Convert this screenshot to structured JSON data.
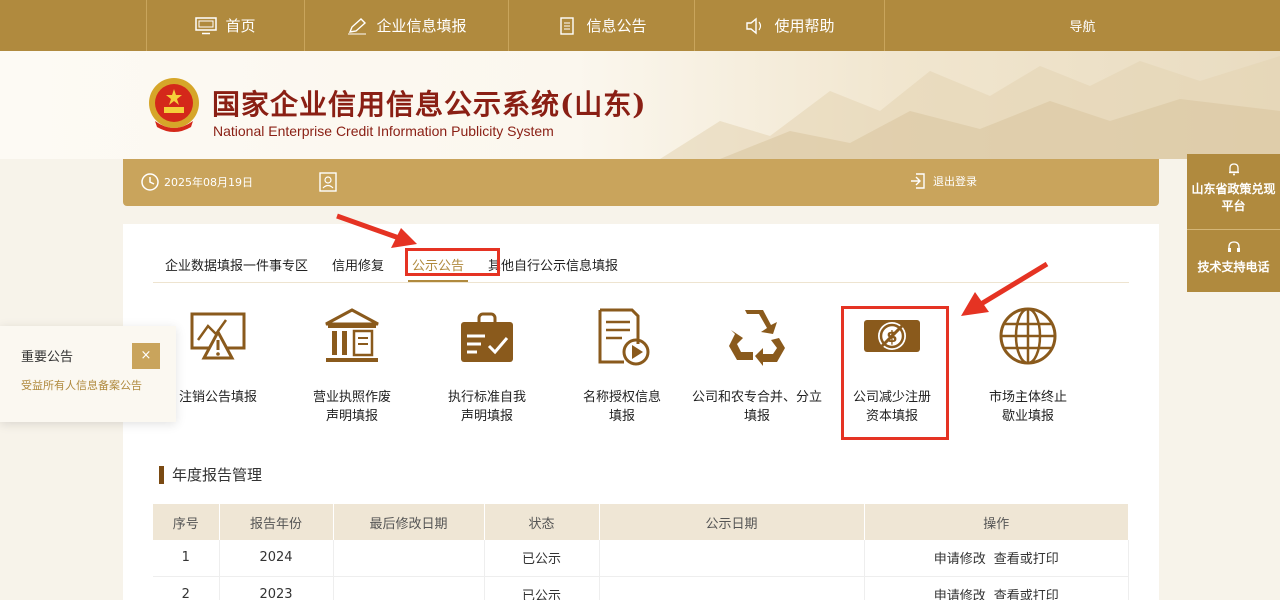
{
  "nav": {
    "home": "首页",
    "fill": "企业信息填报",
    "notice": "信息公告",
    "help": "使用帮助",
    "guide": "导航"
  },
  "header": {
    "title": "国家企业信用信息公示系统(山东)",
    "subtitle": "National Enterprise Credit Information Publicity System"
  },
  "infobar": {
    "date": "2025年08月19日",
    "logout": "退出登录"
  },
  "side": {
    "policy": "山东省政策兑现平台",
    "support": "技术支持电话"
  },
  "tabs": [
    {
      "label": "企业数据填报一件事专区"
    },
    {
      "label": "信用修复"
    },
    {
      "label": "公示公告"
    },
    {
      "label": "其他自行公示信息填报"
    }
  ],
  "functions": [
    {
      "line1": "注销公告填报",
      "line2": "",
      "icon": "cancel-warning-icon"
    },
    {
      "line1": "营业执照作废",
      "line2": "声明填报",
      "icon": "bank-building-icon"
    },
    {
      "line1": "执行标准自我",
      "line2": "声明填报",
      "icon": "clipboard-check-icon"
    },
    {
      "line1": "名称授权信息",
      "line2": "填报",
      "icon": "document-play-icon"
    },
    {
      "line1": "公司和农专合并、分立",
      "line2": "填报",
      "icon": "recycle-icon"
    },
    {
      "line1": "公司减少注册",
      "line2": "资本填报",
      "icon": "no-money-icon"
    },
    {
      "line1": "市场主体终止",
      "line2": "歇业填报",
      "icon": "globe-icon"
    }
  ],
  "annual": {
    "title": "年度报告管理",
    "headers": [
      "序号",
      "报告年份",
      "最后修改日期",
      "状态",
      "公示日期",
      "操作"
    ],
    "rows": [
      {
        "no": "1",
        "year": "2024",
        "modified": "",
        "status": "已公示",
        "published": "",
        "op1": "申请修改",
        "op2": "查看或打印"
      },
      {
        "no": "2",
        "year": "2023",
        "modified": "",
        "status": "已公示",
        "published": "",
        "op1": "申请修改",
        "op2": "查看或打印"
      }
    ]
  },
  "notice": {
    "title": "重要公告",
    "close": "×",
    "text": "受益所有人信息备案公告"
  },
  "colors": {
    "gold": "#b08a3e",
    "lightgold": "#c9a45c",
    "red": "#e53323",
    "titleRed": "#8a1f14"
  }
}
